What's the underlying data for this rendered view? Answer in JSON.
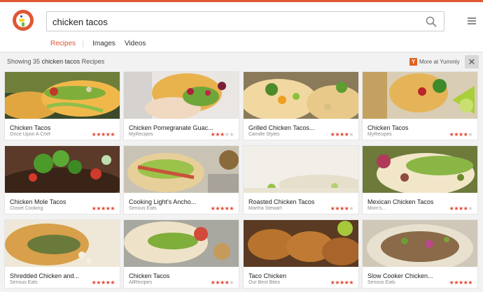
{
  "colors": {
    "accent": "#de5833",
    "star_on": "#e5452f",
    "star_off": "#cccccc"
  },
  "search": {
    "query": "chicken tacos",
    "icon": "search-icon"
  },
  "tabs": [
    {
      "label": "Recipes",
      "active": true
    },
    {
      "label": "Images",
      "active": false
    },
    {
      "label": "Videos",
      "active": false
    }
  ],
  "infobar": {
    "prefix": "Showing 35",
    "query": "chicken tacos",
    "suffix": "Recipes",
    "more_label": "More at Yummly",
    "more_icon_letter": "Y",
    "close_icon": "close-icon"
  },
  "recipes": [
    {
      "title": "Chicken Tacos",
      "source": "Once Upon A Chef",
      "rating": 5,
      "photo": "taco-shells"
    },
    {
      "title": "Chicken Pomegranate Guac...",
      "source": "MyRecipes",
      "rating": 3,
      "photo": "taco-pomegranate"
    },
    {
      "title": "Grilled Chicken Tacos...",
      "source": "Camille Styles",
      "rating": 4,
      "photo": "taco-grilled"
    },
    {
      "title": "Chicken Tacos",
      "source": "MyRecipes",
      "rating": 4,
      "photo": "taco-lime"
    },
    {
      "title": "Chicken Mole Tacos",
      "source": "Closet Cooking",
      "rating": 5,
      "photo": "taco-mole"
    },
    {
      "title": "Cooking Light's Ancho...",
      "source": "Serious Eats",
      "rating": 5,
      "photo": "taco-cabbage"
    },
    {
      "title": "Roasted Chicken Tacos",
      "source": "Martha Stewart",
      "rating": 4,
      "photo": "taco-roasted"
    },
    {
      "title": "Mexican Chicken Tacos",
      "source": "Mom's...",
      "rating": 4,
      "photo": "taco-avocado"
    },
    {
      "title": "Shredded Chicken and...",
      "source": "Serious Eats",
      "rating": 5,
      "photo": "taco-shredded"
    },
    {
      "title": "Chicken Tacos",
      "source": "AllRecipes",
      "rating": 4,
      "photo": "taco-tortilla"
    },
    {
      "title": "Taco Chicken",
      "source": "Our Best Bites",
      "rating": 5,
      "photo": "taco-grilled-meat"
    },
    {
      "title": "Slow Cooker Chicken...",
      "source": "Serious Eats",
      "rating": 5,
      "photo": "taco-slowcooker"
    }
  ]
}
